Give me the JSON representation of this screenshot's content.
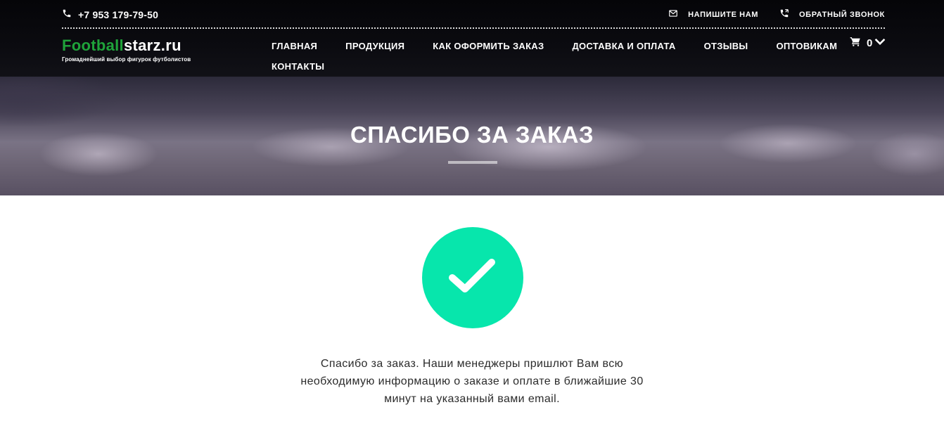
{
  "header": {
    "phone": "+7 953 179-79-50",
    "links": {
      "write_us": "НАПИШИТЕ НАМ",
      "callback": "ОБРАТНЫЙ ЗВОНОК"
    },
    "logo": {
      "part_green": "Football",
      "part_white": "starz.ru",
      "tagline": "Громаднейший выбор фигурок футболистов"
    },
    "nav": {
      "home": "ГЛАВНАЯ",
      "products": "ПРОДУКЦИЯ",
      "how_to_order": "КАК ОФОРМИТЬ ЗАКАЗ",
      "delivery": "ДОСТАВКА И ОПЛАТА",
      "reviews": "ОТЗЫВЫ",
      "wholesale": "ОПТОВИКАМ",
      "contacts": "КОНТАКТЫ"
    },
    "cart": {
      "count": "0"
    }
  },
  "hero": {
    "title": "СПАСИБО ЗА ЗАКАЗ"
  },
  "content": {
    "message": "Спасибо за заказ. Наши менеджеры пришлют Вам всю необходимую информацию о заказе и оплате в ближайшие 30 минут на указанный вами email."
  },
  "icons": {
    "phone": "phone-icon",
    "mail": "envelope-icon",
    "callback": "phone-callback-icon",
    "cart": "cart-icon",
    "chevron": "chevron-down-icon",
    "check": "checkmark-icon"
  },
  "colors": {
    "header_bg": "#0b0b10",
    "logo_green": "#1fa33a",
    "check_circle": "#07e6ac"
  }
}
